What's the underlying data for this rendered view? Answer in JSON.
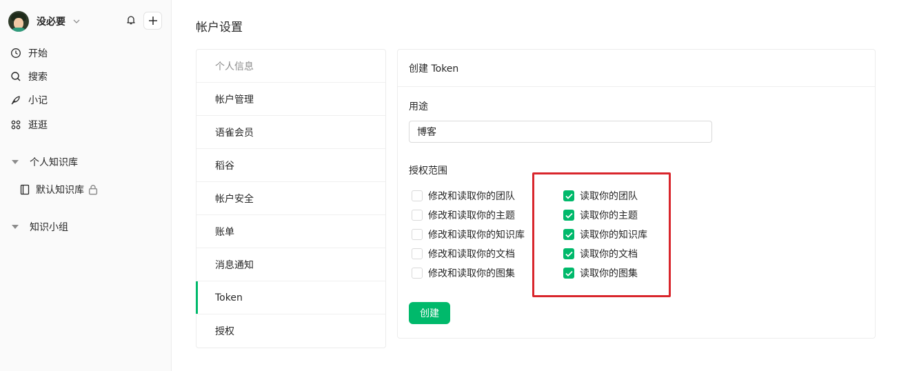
{
  "sidebar": {
    "username": "没必要",
    "nav": [
      "开始",
      "搜索",
      "小记",
      "逛逛"
    ],
    "personal_section": "个人知识库",
    "default_library": "默认知识库",
    "group_section": "知识小组"
  },
  "page_title": "帐户设置",
  "settings_menu": [
    "个人信息",
    "帐户管理",
    "语雀会员",
    "稻谷",
    "帐户安全",
    "账单",
    "消息通知",
    "Token",
    "授权"
  ],
  "panel": {
    "title": "创建 Token",
    "purpose_label": "用途",
    "purpose_value": "博客",
    "scope_label": "授权范围",
    "write_scopes": [
      "修改和读取你的团队",
      "修改和读取你的主题",
      "修改和读取你的知识库",
      "修改和读取你的文档",
      "修改和读取你的图集"
    ],
    "write_checked": [
      false,
      false,
      false,
      false,
      false
    ],
    "read_scopes": [
      "读取你的团队",
      "读取你的主题",
      "读取你的知识库",
      "读取你的文档",
      "读取你的图集"
    ],
    "read_checked": [
      true,
      true,
      true,
      true,
      true
    ],
    "create_button": "创建"
  },
  "colors": {
    "accent": "#00b96b",
    "highlight": "#d9262c"
  }
}
